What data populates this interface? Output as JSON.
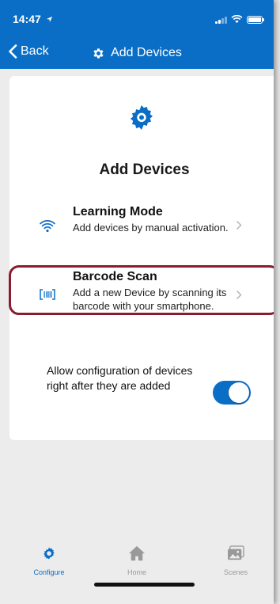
{
  "status_bar": {
    "time": "14:47"
  },
  "nav": {
    "back_label": "Back",
    "title": "Add Devices"
  },
  "card": {
    "title": "Add Devices",
    "options": [
      {
        "icon": "wifi-icon",
        "label": "Learning Mode",
        "description": "Add devices by manual activation."
      },
      {
        "icon": "barcode-icon",
        "label": "Barcode Scan",
        "description": "Add a new Device by scanning its barcode with your smartphone."
      }
    ],
    "setting": {
      "label": "Allow configuration of devices right after they are added",
      "enabled": true
    }
  },
  "tabbar": {
    "tabs": [
      {
        "icon": "gear-icon",
        "label": "Configure",
        "active": true
      },
      {
        "icon": "home-icon",
        "label": "Home",
        "active": false
      },
      {
        "icon": "image-icon",
        "label": "Scenes",
        "active": false
      }
    ]
  },
  "colors": {
    "primary": "#0a6ec7",
    "highlight": "#8a1c2e",
    "background": "#ececec"
  }
}
